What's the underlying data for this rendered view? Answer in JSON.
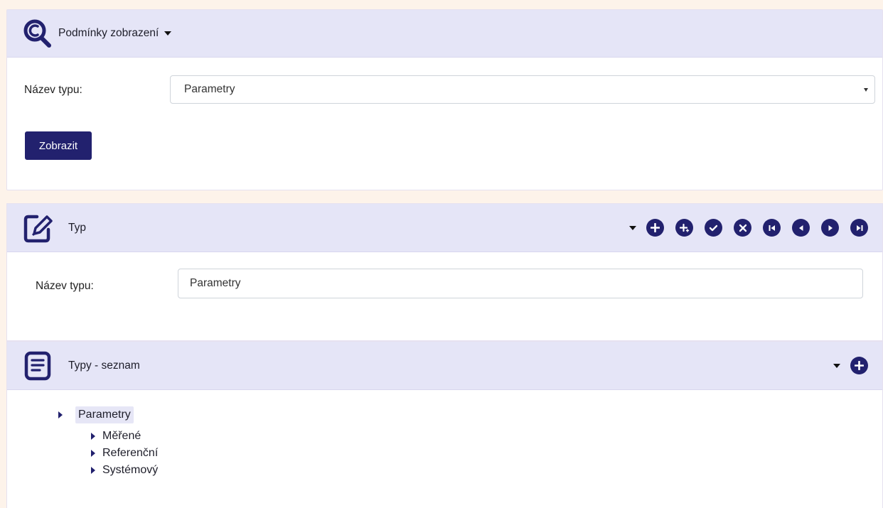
{
  "conditions_panel": {
    "title": "Podmínky zobrazení",
    "field_label": "Název typu:",
    "select_value": "Parametry",
    "submit_label": "Zobrazit"
  },
  "type_panel": {
    "title": "Typ",
    "field_label": "Název typu:",
    "input_value": "Parametry",
    "toolbar_icons": [
      "add-icon",
      "add-child-icon",
      "confirm-icon",
      "cancel-icon",
      "first-record-icon",
      "previous-record-icon",
      "next-record-icon",
      "last-record-icon"
    ]
  },
  "list_panel": {
    "title": "Typy - seznam",
    "tree": {
      "root": "Parametry",
      "children": [
        "Měřené",
        "Referenční",
        "Systémový"
      ]
    }
  },
  "colors": {
    "accent": "#22216e",
    "header_bg": "#e5e5f7",
    "page_bg": "#fdf3ea"
  }
}
